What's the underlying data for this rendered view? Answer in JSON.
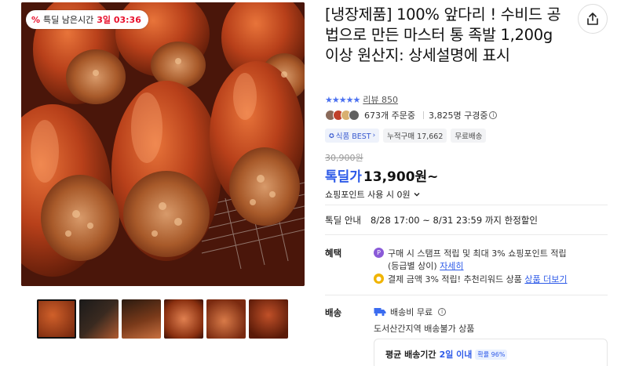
{
  "gallery": {
    "timer": {
      "prefix": "특딜 남은시간",
      "time": "3일 03:36"
    },
    "thumbnail_count": 6
  },
  "product": {
    "title": "[냉장제품] 100% 앞다리 ! 수비드 공법으로 만든 마스터 통 족발 1,200g 이상 원산지: 상세설명에 표시",
    "rating_stars": 4.5,
    "review_label": "리뷰 850",
    "orders": "673개 주문중",
    "watchers": "3,825명 구경중",
    "tags": [
      "식품 BEST",
      "누적구매 17,662",
      "무료배송"
    ],
    "original_price": "30,900원",
    "sale_label": "톡딜가",
    "sale_price": "13,900원~",
    "points_text": "쇼핑포인트 사용 시 0원"
  },
  "deal": {
    "label": "톡딜 안내",
    "period": "8/28 17:00 ~ 8/31 23:59 까지 한정할인"
  },
  "benefits": {
    "label": "혜택",
    "line1": "구매 시 스탬프 적립 및 최대 3% 쇼핑포인트 적립",
    "line1b": "(등급별 상이)",
    "line1_link": "자세히",
    "line2": "결제 금액 3% 적립! 추천리워드 상품",
    "line2_link": "상품 더보기"
  },
  "shipping": {
    "label": "배송",
    "fee": "배송비 무료",
    "note": "도서산간지역 배송불가 상품",
    "avg_label": "평균 배송기간",
    "avg_value": "2일 이내",
    "prob": "확률 96%"
  },
  "colors": {
    "accent_blue": "#2d5ae8",
    "deal_red": "#e8112d",
    "star_blue": "#4a70f0"
  }
}
